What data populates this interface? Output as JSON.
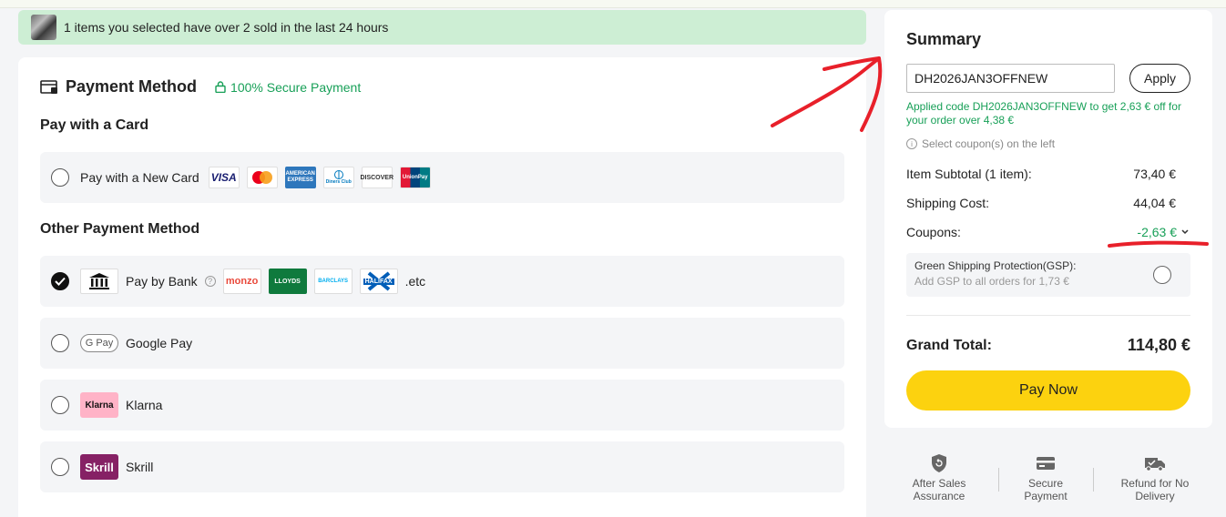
{
  "banner": {
    "text": "1 items you selected have over 2 sold in the last 24 hours"
  },
  "payment": {
    "title": "Payment Method",
    "secure": "100% Secure Payment",
    "card_section": "Pay with a Card",
    "new_card": "Pay with a New Card",
    "card_logos": [
      {
        "name": "visa",
        "label": "VISA"
      },
      {
        "name": "mastercard",
        "label": ""
      },
      {
        "name": "amex",
        "label": "AMERICAN EXPRESS"
      },
      {
        "name": "diners",
        "label": "Diners Club"
      },
      {
        "name": "discover",
        "label": "DISCOVER"
      },
      {
        "name": "unionpay",
        "label": "UnionPay"
      }
    ],
    "other_section": "Other Payment Method",
    "bank": "Pay by Bank",
    "bank_logos": [
      {
        "name": "monzo",
        "label": "monzo"
      },
      {
        "name": "lloyds",
        "label": "LLOYDS"
      },
      {
        "name": "barclays",
        "label": "BARCLAYS"
      },
      {
        "name": "halifax",
        "label": "HALIFAX"
      }
    ],
    "etc": ".etc",
    "google_pay": "Google Pay",
    "gpay_badge": "G Pay",
    "klarna": "Klarna",
    "klarna_badge": "Klarna",
    "skrill": "Skrill",
    "skrill_badge": "Skrill"
  },
  "summary": {
    "title": "Summary",
    "coupon_value": "DH2026JAN3OFFNEW",
    "apply": "Apply",
    "applied_msg": "Applied code DH2026JAN3OFFNEW to get 2,63 € off for your order over 4,38 €",
    "select_hint": "Select coupon(s) on the left",
    "subtotal_label": "Item Subtotal (1 item):",
    "subtotal_value": "73,40 €",
    "shipping_label": "Shipping Cost:",
    "shipping_value": "44,04 €",
    "coupons_label": "Coupons:",
    "coupons_value": "-2,63 €",
    "gsp_title": "Green Shipping Protection(GSP):",
    "gsp_sub": "Add GSP to all orders for 1,73 €",
    "grand_label": "Grand Total:",
    "grand_value": "114,80 €",
    "pay_now": "Pay Now"
  },
  "features": [
    {
      "line1": "After Sales",
      "line2": "Assurance"
    },
    {
      "line1": "Secure",
      "line2": "Payment"
    },
    {
      "line1": "Refund for No",
      "line2": "Delivery"
    }
  ],
  "colors": {
    "accent_green": "#18a058",
    "pay_button": "#fcd20f",
    "banner_bg": "#cdeed4",
    "annotation_red": "#e8202a"
  }
}
